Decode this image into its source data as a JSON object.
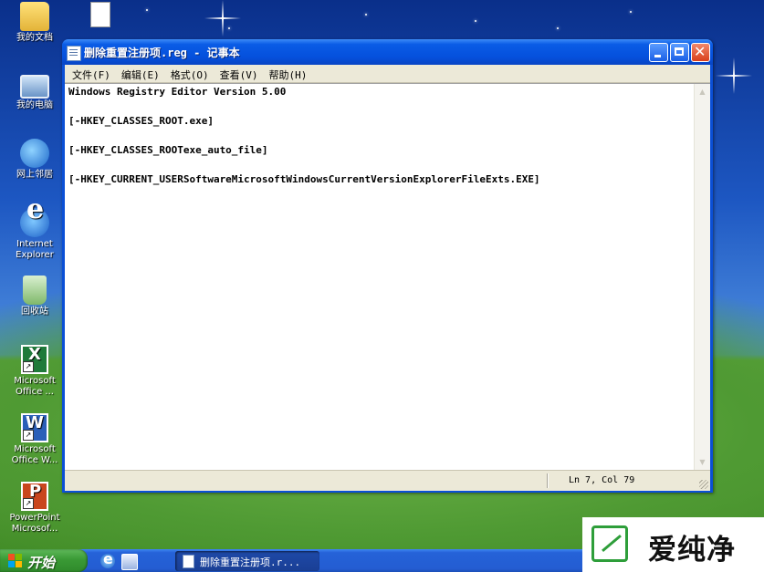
{
  "desktop": {
    "icons": [
      {
        "label": "我的文档",
        "icon": "folder-icon"
      },
      {
        "label": "我的电脑",
        "icon": "computer-icon"
      },
      {
        "label": "网上邻居",
        "icon": "network-icon"
      },
      {
        "label": "Internet Explorer",
        "icon": "ie-icon"
      },
      {
        "label": "回收站",
        "icon": "recycle-bin-icon"
      },
      {
        "label": "Microsoft Office ...",
        "icon": "excel-icon"
      },
      {
        "label": "Microsoft Office W...",
        "icon": "word-icon"
      },
      {
        "label": "PowerPoint Microsof...",
        "icon": "powerpoint-icon"
      }
    ],
    "file_icon": "text-file-icon"
  },
  "window": {
    "title": "删除重置注册项.reg - 记事本",
    "menu": [
      "文件(F)",
      "编辑(E)",
      "格式(O)",
      "查看(V)",
      "帮助(H)"
    ],
    "content_lines": [
      "Windows Registry Editor Version 5.00",
      "[-HKEY_CLASSES_ROOT.exe]",
      "[-HKEY_CLASSES_ROOTexe_auto_file]",
      "[-HKEY_CURRENT_USERSoftwareMicrosoftWindowsCurrentVersionExplorerFileExts.EXE]"
    ],
    "status": "Ln 7, Col 79"
  },
  "taskbar": {
    "start_label": "开始",
    "task_label": "删除重置注册项.r..."
  },
  "watermark": {
    "text": "爱纯净"
  }
}
